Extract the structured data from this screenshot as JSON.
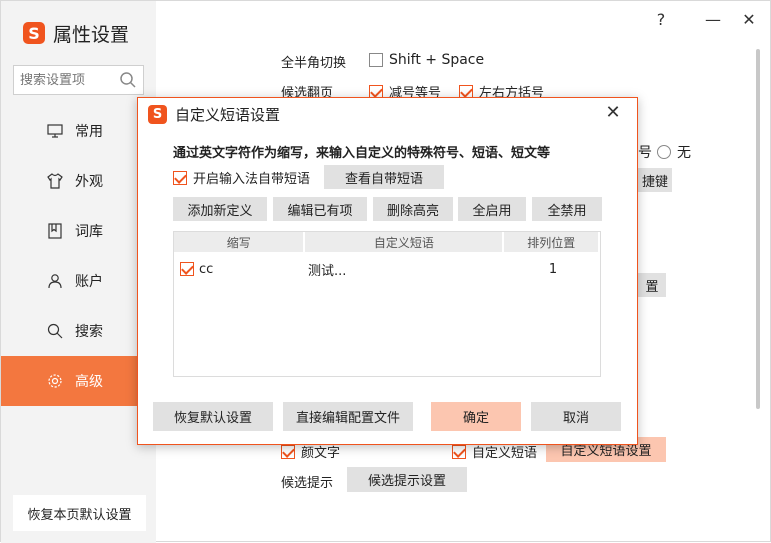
{
  "window": {
    "title": "属性设置",
    "help_icon": "?",
    "minimize_icon": "—",
    "close_icon": "✕"
  },
  "sidebar": {
    "search_placeholder": "搜索设置项",
    "items": [
      {
        "label": "常用",
        "icon": "monitor-icon"
      },
      {
        "label": "外观",
        "icon": "shirt-icon"
      },
      {
        "label": "词库",
        "icon": "book-icon"
      },
      {
        "label": "账户",
        "icon": "user-icon"
      },
      {
        "label": "搜索",
        "icon": "search-icon"
      },
      {
        "label": "高级",
        "icon": "gear-icon",
        "active": true
      }
    ],
    "restore_label": "恢复本页默认设置"
  },
  "background": {
    "fullhalf_label": "全半角切换",
    "shift_space_label": "Shift + Space",
    "page_label": "候选翻页",
    "minus_equal_label": "减号等号",
    "brackets_label": "左右方括号",
    "partial_hao": "号",
    "none_label": "无",
    "partial_jianjian": "捷键",
    "partial_zhi": "置",
    "emoticon_label": "颜文字",
    "custom_phrase_label": "自定义短语",
    "custom_phrase_settings": "自定义短语设置",
    "hint_label": "候选提示",
    "hint_settings": "候选提示设置"
  },
  "dialog": {
    "title": "自定义短语设置",
    "close_icon": "✕",
    "description": "通过英文字符作为缩写，来输入自定义的特殊符号、短语、短文等",
    "enable_label": "开启输入法自带短语",
    "view_builtin": "查看自带短语",
    "toolbar": [
      "添加新定义",
      "编辑已有项",
      "删除高亮",
      "全启用",
      "全禁用"
    ],
    "table": {
      "headers": [
        "缩写",
        "自定义短语",
        "排列位置"
      ],
      "rows": [
        {
          "checked": true,
          "abbr": "cc",
          "phrase": "测试...",
          "position": "1"
        }
      ]
    },
    "restore_default": "恢复默认设置",
    "edit_config": "直接编辑配置文件",
    "ok": "确定",
    "cancel": "取消"
  },
  "colors": {
    "accent": "#f0541e",
    "active_nav": "#f3773f",
    "ok_button": "#fcc6b0"
  }
}
